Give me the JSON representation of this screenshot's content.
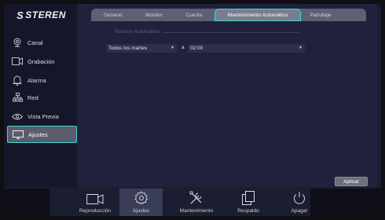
{
  "brand": {
    "logo_text": "STEREN",
    "logo_mark": "S"
  },
  "sidebar": {
    "items": [
      {
        "label": "Canal",
        "icon": "camera-icon"
      },
      {
        "label": "Grabación",
        "icon": "recording-icon"
      },
      {
        "label": "Alarma",
        "icon": "bell-icon"
      },
      {
        "label": "Red",
        "icon": "network-icon"
      },
      {
        "label": "Vista Previa",
        "icon": "eye-icon"
      },
      {
        "label": "Ajustes",
        "icon": "monitor-icon",
        "active": true
      }
    ]
  },
  "tabs": [
    {
      "label": "General"
    },
    {
      "label": "Monitor"
    },
    {
      "label": "Cuenta"
    },
    {
      "label": "Mantenimiento Automático",
      "active": true
    },
    {
      "label": "Patrullaje"
    }
  ],
  "maintenance": {
    "section_title": "Reinicio Automático",
    "day_value": "Todos los martes",
    "separator": "a",
    "time_value": "02:00"
  },
  "actions": {
    "apply_label": "Aplicar"
  },
  "bottom_nav": [
    {
      "label": "Reproducción",
      "icon": "camera-video-icon"
    },
    {
      "label": "Ajustes",
      "icon": "gear-icon",
      "active": true
    },
    {
      "label": "Mantenimiento",
      "icon": "tools-icon"
    },
    {
      "label": "Respaldo",
      "icon": "copy-icon"
    },
    {
      "label": "Apagar",
      "icon": "power-icon"
    }
  ],
  "colors": {
    "accent": "#3bd6cf",
    "background": "#1c1d2c",
    "panel": "#20213d"
  }
}
